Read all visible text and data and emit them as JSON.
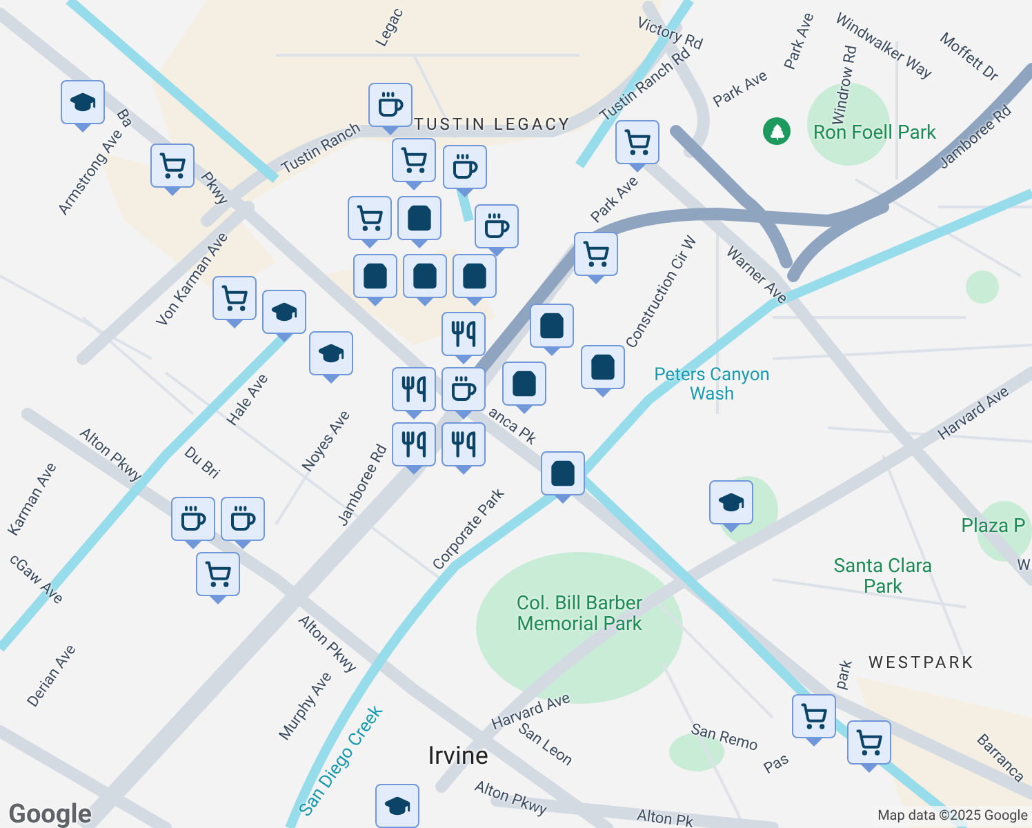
{
  "labels": [
    {
      "text": "Legac",
      "kind": "road"
    },
    {
      "text": "Victory Rd",
      "kind": "road"
    },
    {
      "text": "Park Ave",
      "kind": "road"
    },
    {
      "text": "Windwalker Way",
      "kind": "road"
    },
    {
      "text": "Moffett Dr",
      "kind": "road"
    },
    {
      "text": "Windrow Rd",
      "kind": "road"
    },
    {
      "text": "TUSTIN LEGACY",
      "kind": "district"
    },
    {
      "text": "Tustin Ranch Rd",
      "kind": "road"
    },
    {
      "text": "Tustin Ranch",
      "kind": "road"
    },
    {
      "text": "Park Ave",
      "kind": "road"
    },
    {
      "text": "Ron Foell Park",
      "kind": "park"
    },
    {
      "text": "Jamboree Rd",
      "kind": "road"
    },
    {
      "text": "Armstrong Ave",
      "kind": "road"
    },
    {
      "text": "Ba",
      "kind": "road"
    },
    {
      "text": "Pkwy",
      "kind": "road"
    },
    {
      "text": "Park Ave",
      "kind": "road"
    },
    {
      "text": "Warner Ave",
      "kind": "road"
    },
    {
      "text": "Construction Cir W",
      "kind": "road"
    },
    {
      "text": "Von Karman Ave",
      "kind": "road"
    },
    {
      "text": "Hale Ave",
      "kind": "road"
    },
    {
      "text": "Peters Canyon Wash",
      "kind": "water"
    },
    {
      "text": "Harvard Ave",
      "kind": "road"
    },
    {
      "text": "Alton Pkwy",
      "kind": "road"
    },
    {
      "text": "Noyes Ave",
      "kind": "road"
    },
    {
      "text": "Jamboree Rd",
      "kind": "road"
    },
    {
      "text": "anca Pk",
      "kind": "road"
    },
    {
      "text": "Karman Ave",
      "kind": "road"
    },
    {
      "text": "Du Bri",
      "kind": "road"
    },
    {
      "text": "cGaw Ave",
      "kind": "road"
    },
    {
      "text": "Corporate Park",
      "kind": "road"
    },
    {
      "text": "Plaza P",
      "kind": "park"
    },
    {
      "text": "W",
      "kind": "road"
    },
    {
      "text": "Santa Clara Park",
      "kind": "park"
    },
    {
      "text": "Col. Bill Barber Memorial Park",
      "kind": "park"
    },
    {
      "text": "WESTPARK",
      "kind": "district"
    },
    {
      "text": "Alton Pkwy",
      "kind": "road"
    },
    {
      "text": "Murphy Ave",
      "kind": "road"
    },
    {
      "text": "Derian Ave",
      "kind": "road"
    },
    {
      "text": "Harvard Ave",
      "kind": "road"
    },
    {
      "text": "San Leon",
      "kind": "road"
    },
    {
      "text": "San Remo",
      "kind": "road"
    },
    {
      "text": "Pas",
      "kind": "road"
    },
    {
      "text": "park",
      "kind": "road"
    },
    {
      "text": "Barranca",
      "kind": "road"
    },
    {
      "text": "Irvine",
      "kind": "city"
    },
    {
      "text": "San Diego Creek",
      "kind": "water"
    },
    {
      "text": "Alton Pkwy",
      "kind": "road"
    },
    {
      "text": "Alton Pk",
      "kind": "road"
    }
  ],
  "pins": [
    {
      "kind": "school"
    },
    {
      "kind": "cart"
    },
    {
      "kind": "coffee"
    },
    {
      "kind": "cart"
    },
    {
      "kind": "coffee"
    },
    {
      "kind": "cart"
    },
    {
      "kind": "coffee"
    },
    {
      "kind": "bag"
    },
    {
      "kind": "bag"
    },
    {
      "kind": "bag"
    },
    {
      "kind": "dining"
    },
    {
      "kind": "bag"
    },
    {
      "kind": "cart"
    },
    {
      "kind": "school"
    },
    {
      "kind": "school"
    },
    {
      "kind": "dining"
    },
    {
      "kind": "coffee"
    },
    {
      "kind": "dining"
    },
    {
      "kind": "dining"
    },
    {
      "kind": "bag"
    },
    {
      "kind": "bag"
    },
    {
      "kind": "bag"
    },
    {
      "kind": "cart"
    },
    {
      "kind": "cart"
    },
    {
      "kind": "bag"
    },
    {
      "kind": "school"
    },
    {
      "kind": "coffee"
    },
    {
      "kind": "coffee"
    },
    {
      "kind": "cart"
    },
    {
      "kind": "cart"
    },
    {
      "kind": "cart"
    },
    {
      "kind": "school"
    }
  ],
  "logo": "Google",
  "attribution": "Map data ©2025 Google"
}
